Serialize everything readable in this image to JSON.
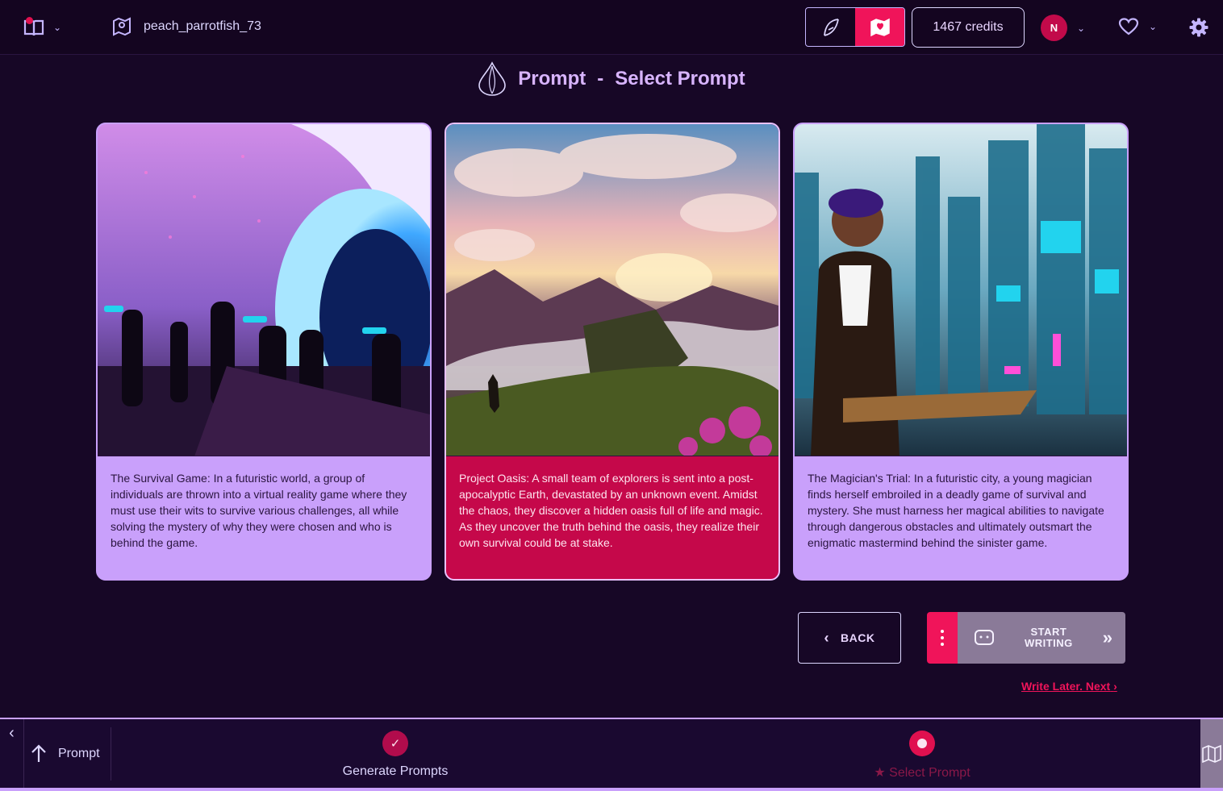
{
  "header": {
    "username": "peach_parrotfish_73",
    "credits": "1467 credits",
    "avatar_initial": "N"
  },
  "page": {
    "title_part1": "Prompt",
    "separator": "-",
    "title_part2": "Select Prompt"
  },
  "prompts": [
    {
      "text": "The Survival Game: In a futuristic world, a group of individuals are thrown into a virtual reality game where they must use their wits to survive various challenges, all while solving the mystery of why they were chosen and who is behind the game.",
      "selected": false
    },
    {
      "text": "Project Oasis: A small team of explorers is sent into a post-apocalyptic Earth, devastated by an unknown event. Amidst the chaos, they discover a hidden oasis full of life and magic. As they uncover the truth behind the oasis, they realize their own survival could be at stake.",
      "selected": true
    },
    {
      "text": "The Magician's Trial: In a futuristic city, a young magician finds herself embroiled in a deadly game of survival and mystery. She must harness her magical abilities to navigate through dangerous obstacles and ultimately outsmart the enigmatic mastermind behind the sinister game.",
      "selected": false
    }
  ],
  "actions": {
    "back_label": "BACK",
    "start_writing_line1": "START",
    "start_writing_line2": "WRITING",
    "write_later": "Write Later. Next"
  },
  "bottombar": {
    "section_label": "Prompt",
    "steps": [
      {
        "label": "Generate Prompts",
        "status": "complete"
      },
      {
        "label": "Select Prompt",
        "status": "current"
      }
    ]
  },
  "colors": {
    "accent": "#f0145a",
    "card_bg": "#c9a0fb",
    "selected_card_bg": "#c5084a",
    "page_bg": "#170726"
  }
}
